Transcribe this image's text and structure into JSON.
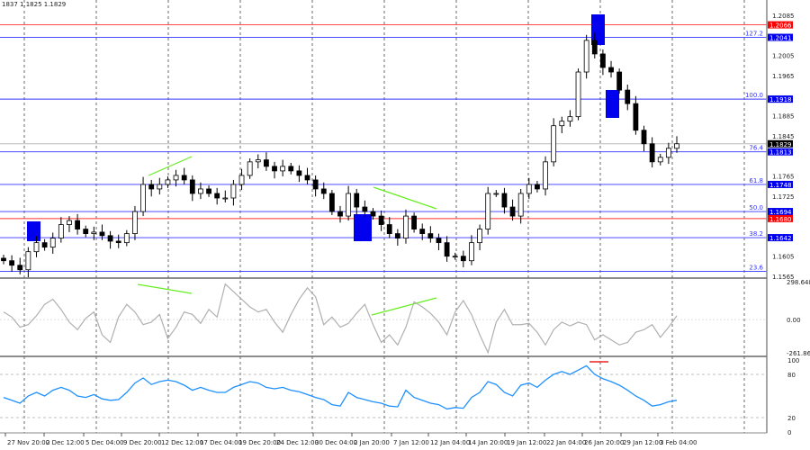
{
  "header": {
    "ohlc_text": "1837 1.1825 1.1829"
  },
  "colors": {
    "candle": "#000000",
    "fib_line": "#3333ff",
    "level_red": "#ff3333",
    "marker_box": "#0000ee",
    "divergence": "#66ee22",
    "cci": "#b0b0b0",
    "rsi": "#1e90ff"
  },
  "chart_data": [
    {
      "type": "candlestick",
      "panel": "price",
      "closes": [
        1.1596,
        1.1587,
        1.1578,
        1.1614,
        1.1632,
        1.1623,
        1.1641,
        1.1668,
        1.1676,
        1.1659,
        1.165,
        1.1653,
        1.1646,
        1.1635,
        1.1632,
        1.165,
        1.1694,
        1.1748,
        1.1739,
        1.1748,
        1.1757,
        1.1766,
        1.1757,
        1.173,
        1.1739,
        1.173,
        1.1721,
        1.1721,
        1.1748,
        1.1766,
        1.1793,
        1.1797,
        1.1784,
        1.1775,
        1.1784,
        1.1775,
        1.1766,
        1.1757,
        1.1739,
        1.173,
        1.1694,
        1.1685,
        1.173,
        1.1703,
        1.1694,
        1.1685,
        1.1668,
        1.165,
        1.1641,
        1.1685,
        1.1659,
        1.165,
        1.1641,
        1.1632,
        1.1605,
        1.1605,
        1.1596,
        1.1632,
        1.1659,
        1.173,
        1.173,
        1.1703,
        1.1685,
        1.173,
        1.1748,
        1.1739,
        1.1793,
        1.1865,
        1.1874,
        1.1883,
        1.1972,
        1.2035,
        1.2008,
        1.1981,
        1.1972,
        1.1936,
        1.1909,
        1.1856,
        1.1829,
        1.1793,
        1.1802,
        1.182,
        1.1829
      ],
      "ylim": [
        1.1565,
        1.2085
      ],
      "y_ticks": [
        "1.2085",
        "1.2005",
        "1.1965",
        "1.1885",
        "1.1845",
        "1.1765",
        "1.1725",
        "1.1605",
        "1.1565"
      ],
      "x_ticks": [
        "27 Nov 20:00",
        "2 Dec 12:00",
        "5 Dec 04:00",
        "9 Dec 20:00",
        "12 Dec 12:00",
        "17 Dec 04:00",
        "19 Dec 20:00",
        "24 Dec 12:00",
        "30 Dec 04:00",
        "2 Jan 20:00",
        "7 Jan 12:00",
        "12 Jan 04:00",
        "14 Jan 20:00",
        "19 Jan 12:00",
        "22 Jan 04:00",
        "26 Jan 20:00",
        "29 Jan 12:00",
        "3 Feb 04:00"
      ],
      "current_price": "1.1829",
      "fib_levels": [
        {
          "label": "127.2",
          "price": "1.2041"
        },
        {
          "label": "100.0",
          "price": "1.1918"
        },
        {
          "label": "76.4",
          "price": "1.1813"
        },
        {
          "label": "61.8",
          "price": "1.1748"
        },
        {
          "label": "50.0",
          "price": "1.1694"
        },
        {
          "label": "38.2",
          "price": "1.1642"
        },
        {
          "label": "23.6",
          "price": "1.1575"
        }
      ],
      "red_levels": [
        "1.2066",
        "1.1680"
      ]
    },
    {
      "type": "line",
      "panel": "cci",
      "ylim": [
        -261.864,
        298.6486
      ],
      "y_ticks": [
        "298.6486",
        "0.00",
        "-261.864"
      ],
      "values": [
        60,
        20,
        -60,
        -40,
        30,
        120,
        160,
        80,
        -20,
        -80,
        10,
        60,
        -120,
        -180,
        20,
        120,
        60,
        -40,
        -20,
        40,
        -150,
        -60,
        60,
        40,
        -30,
        80,
        20,
        280,
        220,
        160,
        100,
        60,
        80,
        -20,
        -100,
        40,
        160,
        250,
        180,
        -40,
        20,
        -60,
        -30,
        50,
        120,
        -40,
        -180,
        -120,
        -200,
        -60,
        140,
        100,
        50,
        -20,
        -120,
        60,
        150,
        40,
        -120,
        -260,
        -20,
        80,
        -40,
        -40,
        -30,
        -100,
        -200,
        -80,
        -20,
        -50,
        -20,
        -40,
        -160,
        -120,
        -160,
        -200,
        -180,
        -100,
        -80,
        -40,
        -140,
        -60,
        30
      ],
      "divergence": true
    },
    {
      "type": "line",
      "panel": "rsi",
      "ylim": [
        0,
        100
      ],
      "y_ticks": [
        "100",
        "80",
        "20",
        "0"
      ],
      "levels": [
        80,
        20
      ],
      "values": [
        48,
        44,
        40,
        50,
        55,
        50,
        58,
        62,
        58,
        50,
        48,
        52,
        46,
        44,
        45,
        55,
        68,
        75,
        66,
        70,
        72,
        70,
        65,
        58,
        62,
        58,
        55,
        55,
        62,
        66,
        70,
        68,
        62,
        60,
        62,
        58,
        56,
        52,
        48,
        45,
        38,
        36,
        55,
        48,
        45,
        42,
        40,
        36,
        35,
        58,
        48,
        44,
        40,
        38,
        32,
        34,
        33,
        48,
        55,
        70,
        66,
        55,
        50,
        65,
        68,
        62,
        72,
        80,
        84,
        80,
        86,
        92,
        80,
        74,
        70,
        65,
        58,
        50,
        44,
        36,
        38,
        42,
        44
      ]
    }
  ]
}
